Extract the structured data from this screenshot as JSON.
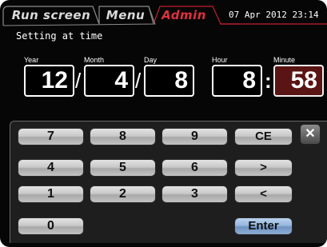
{
  "header": {
    "tabs": [
      {
        "label": "Run screen",
        "active": false
      },
      {
        "label": "Menu",
        "active": false
      },
      {
        "label": "Admin",
        "active": true
      }
    ],
    "datetime": "07 Apr 2012 23:14"
  },
  "screen_title": "Setting at time",
  "fields": {
    "year": {
      "label": "Year",
      "value": "12"
    },
    "month": {
      "label": "Month",
      "value": "4"
    },
    "day": {
      "label": "Day",
      "value": "8"
    },
    "hour": {
      "label": "Hour",
      "value": "8"
    },
    "minute": {
      "label": "Minute",
      "value": "58",
      "selected": true
    }
  },
  "separators": {
    "date": "/",
    "time": ":"
  },
  "keypad": {
    "k7": "7",
    "k8": "8",
    "k9": "9",
    "ce": "CE",
    "k4": "4",
    "k5": "5",
    "k6": "6",
    "right": ">",
    "k1": "1",
    "k2": "2",
    "k3": "3",
    "left": "<",
    "k0": "0",
    "enter": "Enter",
    "clear": "✕"
  },
  "colors": {
    "background": "#060606",
    "active_tab": "#e0303e",
    "selected_field": "#5a1414",
    "enter_key": "#8eaed6"
  }
}
